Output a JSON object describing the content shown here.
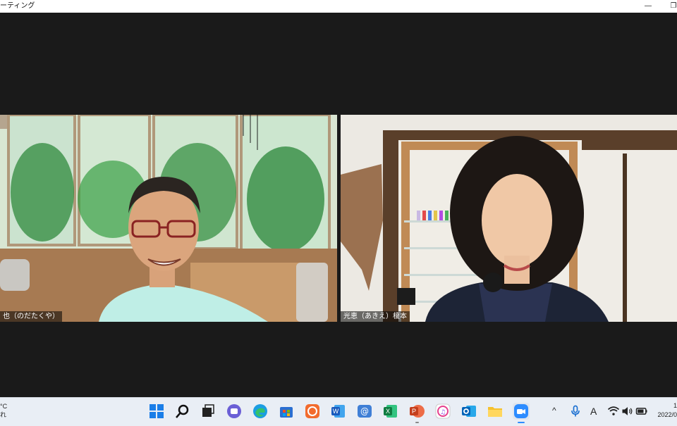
{
  "window": {
    "title": "ーティング",
    "minimize_label": "—",
    "restore_label": "❐"
  },
  "participants": [
    {
      "name": "也（のだたくや）"
    },
    {
      "name": "光恵（あきえ）榎本"
    }
  ],
  "taskbar": {
    "weather_line1": "°C",
    "weather_line2": "れ",
    "apps": [
      "start-icon",
      "search-icon",
      "task-view-icon",
      "teams-chat-icon",
      "edge-icon",
      "store-icon",
      "app-orange-icon",
      "word-icon",
      "mail-at-icon",
      "excel-icon",
      "powerpoint-icon",
      "itunes-icon",
      "outlook-icon",
      "file-explorer-icon",
      "zoom-icon"
    ],
    "tray": {
      "chevron": "^",
      "ime": "A"
    },
    "clock_time": "1",
    "clock_date": "2022/0"
  },
  "colors": {
    "background": "#1a1a1a",
    "taskbar": "#e9eef5",
    "zoom_blue": "#2d8cff"
  }
}
